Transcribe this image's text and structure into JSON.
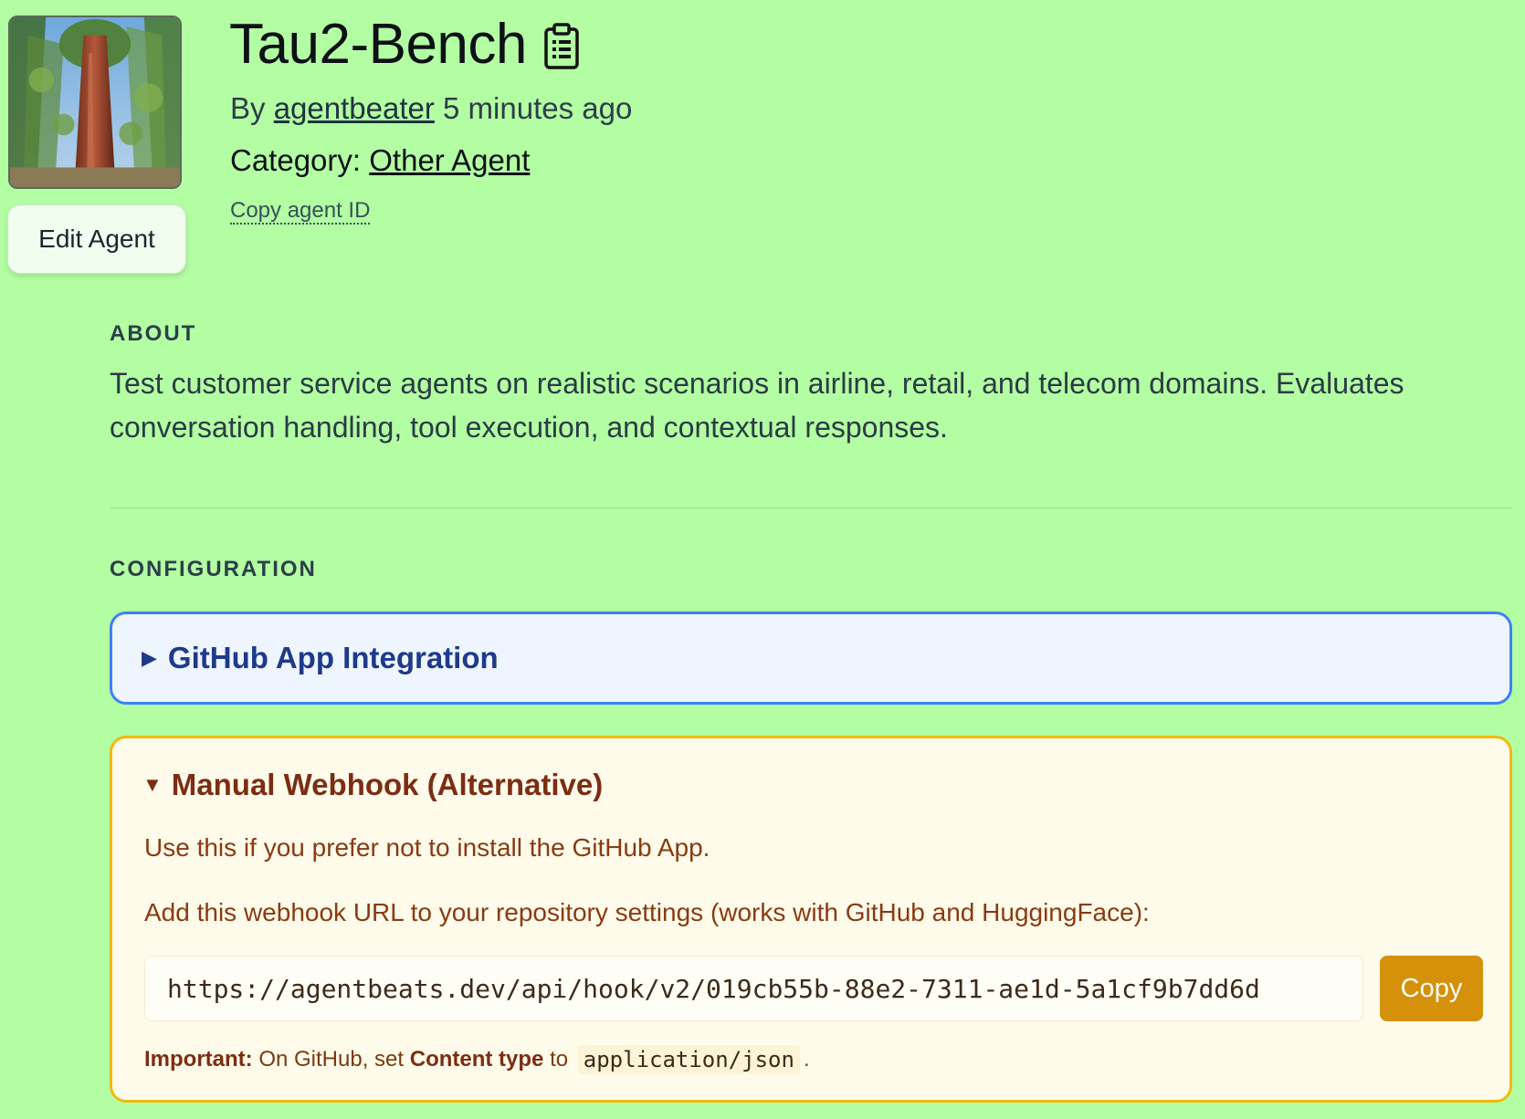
{
  "header": {
    "title": "Tau2-Bench",
    "by_prefix": "By",
    "author": "agentbeater",
    "time_ago": "5 minutes ago",
    "category_label": "Category:",
    "category_value": "Other Agent",
    "copy_id_label": "Copy agent ID",
    "edit_button_label": "Edit Agent",
    "title_icon": "clipboard-icon"
  },
  "about": {
    "label": "ABOUT",
    "text": "Test customer service agents on realistic scenarios in airline, retail, and telecom domains. Evaluates conversation handling, tool execution, and contextual responses."
  },
  "configuration": {
    "label": "CONFIGURATION",
    "github_panel": {
      "title": "GitHub App Integration",
      "expanded": false
    },
    "webhook_panel": {
      "title": "Manual Webhook (Alternative)",
      "expanded": true,
      "line1": "Use this if you prefer not to install the GitHub App.",
      "line2": "Add this webhook URL to your repository settings (works with GitHub and HuggingFace):",
      "url": "https://agentbeats.dev/api/hook/v2/019cb55b-88e2-7311-ae1d-5a1cf9b7dd6d",
      "copy_button_label": "Copy",
      "note_important": "Important:",
      "note_text1": " On GitHub, set ",
      "note_bold": "Content type",
      "note_text2": " to ",
      "note_code": "application/json",
      "note_end": "."
    }
  },
  "colors": {
    "page_bg": "#b3fda3",
    "github_border": "#3b82f6",
    "github_bg": "#eff5fe",
    "webhook_border": "#f2b90f",
    "webhook_bg": "#fffbeb",
    "copy_button": "#d6910a"
  }
}
